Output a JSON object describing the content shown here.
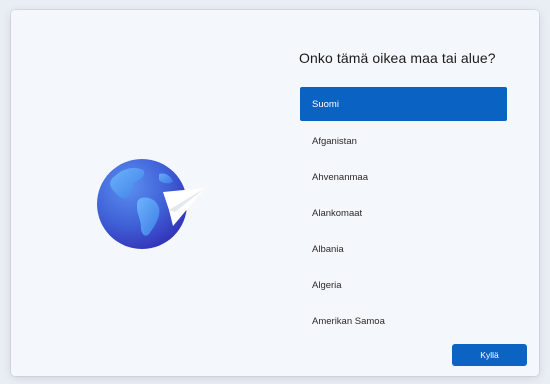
{
  "setup": {
    "question": "Onko tämä oikea maa tai alue?",
    "regions": [
      {
        "label": "Suomi",
        "selected": true
      },
      {
        "label": "Afganistan",
        "selected": false
      },
      {
        "label": "Ahvenanmaa",
        "selected": false
      },
      {
        "label": "Alankomaat",
        "selected": false
      },
      {
        "label": "Albania",
        "selected": false
      },
      {
        "label": "Algeria",
        "selected": false
      },
      {
        "label": "Amerikan Samoa",
        "selected": false
      }
    ],
    "confirm_label": "Kyllä"
  },
  "colors": {
    "accent": "#0a62c2",
    "globe_dark": "#3b3fc8",
    "globe_light": "#4f8fe8"
  },
  "icons": {
    "illustration": "globe-with-paper-plane-icon"
  }
}
